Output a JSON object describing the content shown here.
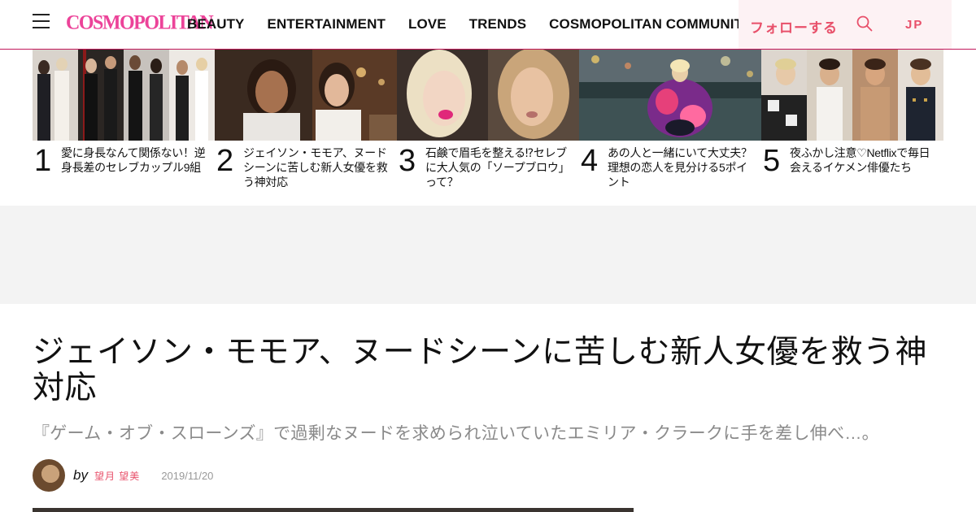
{
  "header": {
    "logo": "COSMOPOLITAN",
    "nav": [
      "BEAUTY",
      "ENTERTAINMENT",
      "LOVE",
      "TRENDS",
      "COSMOPOLITAN COMMUNITY"
    ],
    "follow": "フォローする",
    "edition": "JP",
    "brand_color": "#ec4399",
    "accent_color": "#e8506a"
  },
  "trending": [
    {
      "rank": "1",
      "title": "愛に身長なんて関係ない！逆身長差のセレブカップル9組"
    },
    {
      "rank": "2",
      "title": "ジェイソン・モモア、ヌードシーンに苦しむ新人女優を救う神対応"
    },
    {
      "rank": "3",
      "title": "石鹸で眉毛を整える⁉セレブに大人気の「ソープブロウ」って？"
    },
    {
      "rank": "4",
      "title": "あの人と一緒にいて大丈夫？理想の恋人を見分ける5ポイント"
    },
    {
      "rank": "5",
      "title": "夜ふかし注意♡Netflixで毎日会えるイケメン俳優たち"
    }
  ],
  "article": {
    "headline": "ジェイソン・モモア、ヌードシーンに苦しむ新人女優を救う神対応",
    "dek": "『ゲーム・オブ・スローンズ』で過剰なヌードを求められ泣いていたエミリア・クラークに手を差し伸べ…。",
    "by": "by",
    "author": "望月 望美",
    "date": "2019/11/20"
  }
}
